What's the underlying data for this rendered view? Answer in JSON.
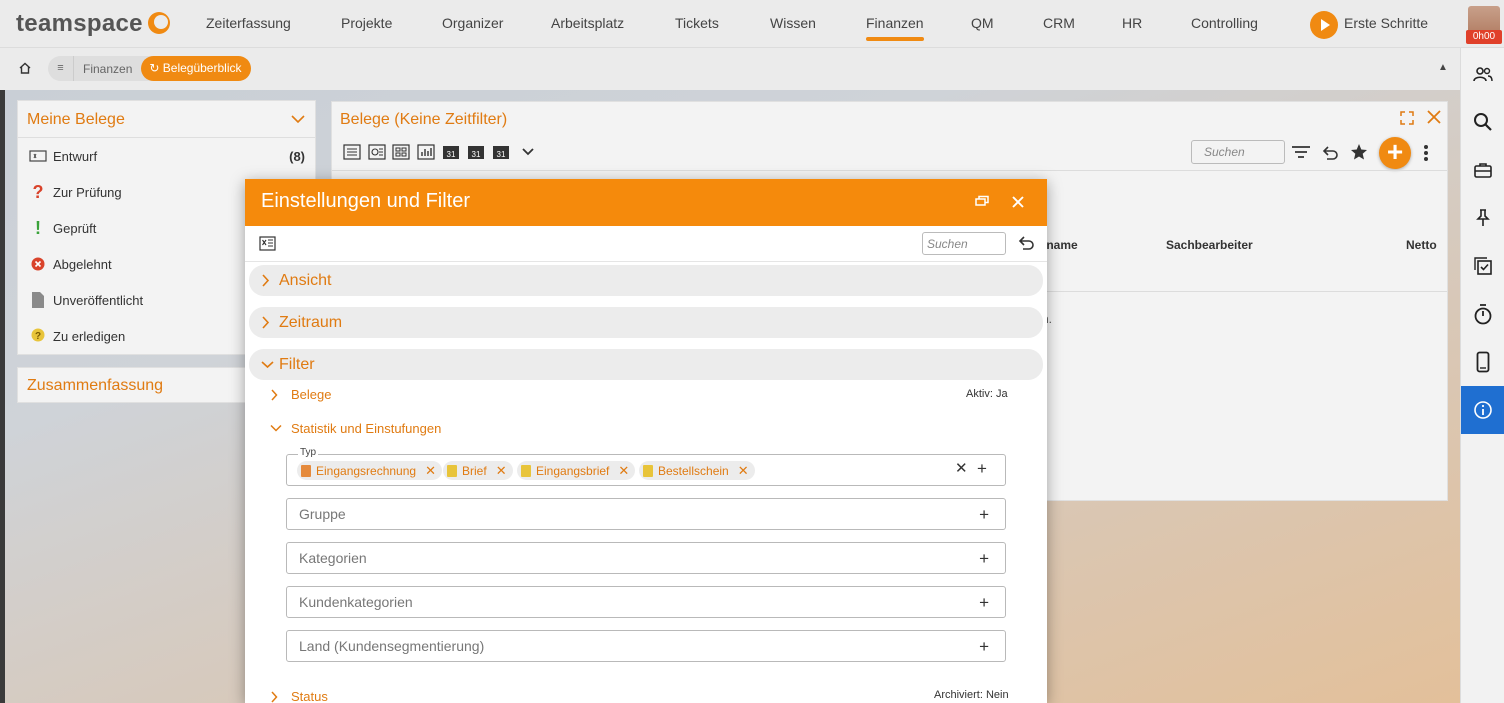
{
  "app": {
    "logo": "teamspace"
  },
  "nav": {
    "items": [
      "Zeiterfassung",
      "Projekte",
      "Organizer",
      "Arbeitsplatz",
      "Tickets",
      "Wissen",
      "Finanzen",
      "QM",
      "CRM",
      "HR",
      "Controlling"
    ],
    "active": "Finanzen",
    "first_steps": "Erste Schritte",
    "timer_badge": "0h00"
  },
  "breadcrumb": {
    "menu": "≡",
    "parent": "Finanzen",
    "current": "Belegüberblick"
  },
  "left_panel": {
    "title": "Meine Belege",
    "items": [
      {
        "label": "Entwurf",
        "count": "(8)",
        "icon": "draft-icon"
      },
      {
        "label": "Zur Prüfung",
        "count": "",
        "icon": "question-icon"
      },
      {
        "label": "Geprüft",
        "count": "",
        "icon": "exclamation-icon"
      },
      {
        "label": "Abgelehnt",
        "count": "",
        "icon": "rejected-icon"
      },
      {
        "label": "Unveröffentlicht",
        "count": "",
        "icon": "unpublished-icon"
      },
      {
        "label": "Zu erledigen",
        "count": "",
        "icon": "todo-icon"
      }
    ],
    "summary": "Zusammenfassung"
  },
  "main_panel": {
    "title": "Belege (Keine Zeitfilter)",
    "search_placeholder": "Suchen",
    "add_label": "+",
    "columns": [
      "gname",
      "Sachbearbeiter",
      "Netto"
    ],
    "empty_text": "n."
  },
  "dialog": {
    "title": "Einstellungen und Filter",
    "search_placeholder": "Suchen",
    "sections": [
      "Ansicht",
      "Zeitraum",
      "Filter"
    ],
    "subsections": {
      "belege": {
        "label": "Belege",
        "status": "Aktiv: Ja"
      },
      "statistik": {
        "label": "Statistik und Einstufungen"
      },
      "status": {
        "label": "Status",
        "status": "Archiviert: Nein"
      }
    },
    "typ": {
      "legend": "Typ",
      "chips": [
        {
          "label": "Eingangsrechnung",
          "color": "#e58a3c"
        },
        {
          "label": "Brief",
          "color": "#e8c43a"
        },
        {
          "label": "Eingangsbrief",
          "color": "#e8c43a"
        },
        {
          "label": "Bestellschein",
          "color": "#e8c43a"
        }
      ]
    },
    "fields": [
      "Gruppe",
      "Kategorien",
      "Kundenkategorien",
      "Land (Kundensegmentierung)"
    ]
  },
  "colors": {
    "accent": "#f08a12",
    "accent_text": "#e07b12",
    "info_active": "#1f6fd1"
  }
}
